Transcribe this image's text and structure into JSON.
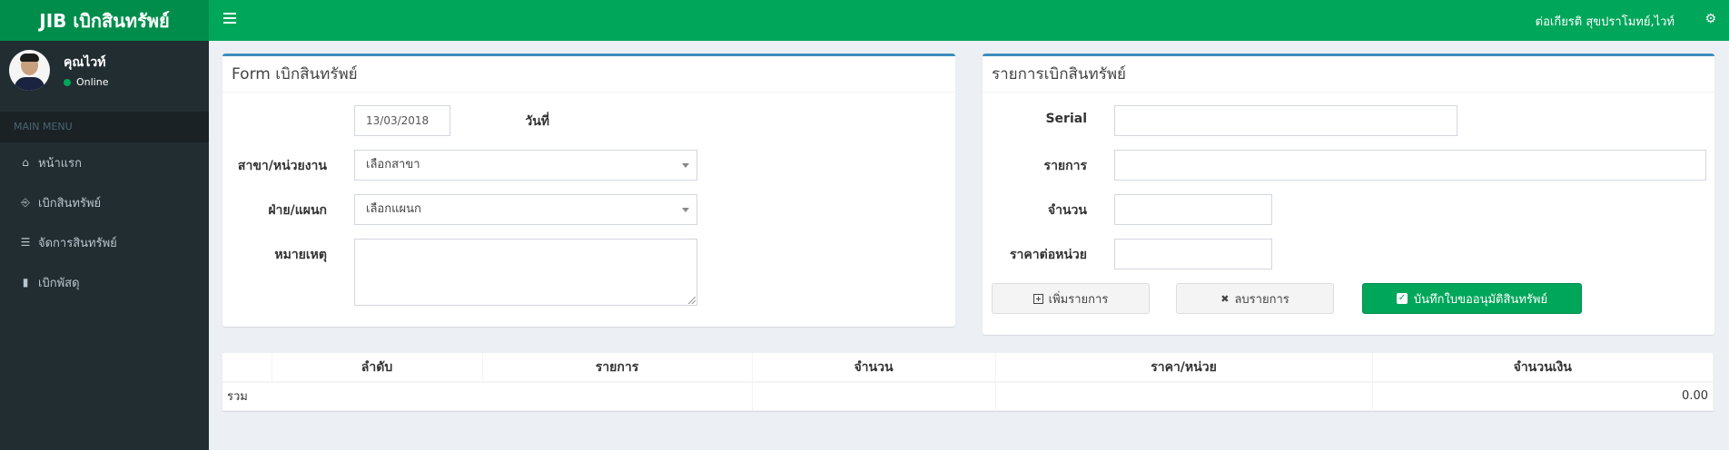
{
  "header": {
    "app_title": "JIB เบิกสินทรัพย์",
    "user_full_name": "ต่อเกียรติ สุขปราโมทย์,ไวท์",
    "menu_toggle_icon": "bars-icon",
    "settings_icon": "cogs-icon"
  },
  "sidebar": {
    "user_name": "คุณไวท์",
    "status": "Online",
    "status_color": "#00a65a",
    "menu_header": "MAIN MENU",
    "items": [
      {
        "label": "หน้าแรก",
        "icon": "home-icon"
      },
      {
        "label": "เบิกสินทรัพย์",
        "icon": "cart-icon"
      },
      {
        "label": "จัดการสินทรัพย์",
        "icon": "database-icon"
      },
      {
        "label": "เบิกพัสดุ",
        "icon": "book-icon"
      }
    ]
  },
  "form": {
    "title": "Form เบิกสินทรัพย์",
    "date_label": "วันที่",
    "date_value": "13/03/2018",
    "branch_label": "สาขา/หน่วยงาน",
    "branch_selected": "เลือกสาขา",
    "dept_label": "ฝ่าย/แผนก",
    "dept_selected": "เลือกแผนก",
    "note_label": "หมายเหตุ",
    "note_value": ""
  },
  "items_panel": {
    "title": "รายการเบิกสินทรัพย์",
    "serial_label": "Serial",
    "item_label": "รายการ",
    "qty_label": "จำนวน",
    "price_label": "ราคาต่อหน่วย",
    "add_button": "เพิ่มรายการ",
    "remove_button": "ลบรายการ",
    "save_button": "บันทึกใบขออนุมัติสินทรัพย์"
  },
  "table": {
    "columns": [
      "",
      "ลำดับ",
      "รายการ",
      "จำนวน",
      "ราคา/หน่วย",
      "จำนวนเงิน"
    ],
    "total_label": "รวม",
    "total_value": "0.00"
  },
  "colors": {
    "header_green": "#00a65a",
    "logo_green": "#008d4c",
    "sidebar_dark": "#222d32",
    "box_border_blue": "#3c8dbc"
  }
}
